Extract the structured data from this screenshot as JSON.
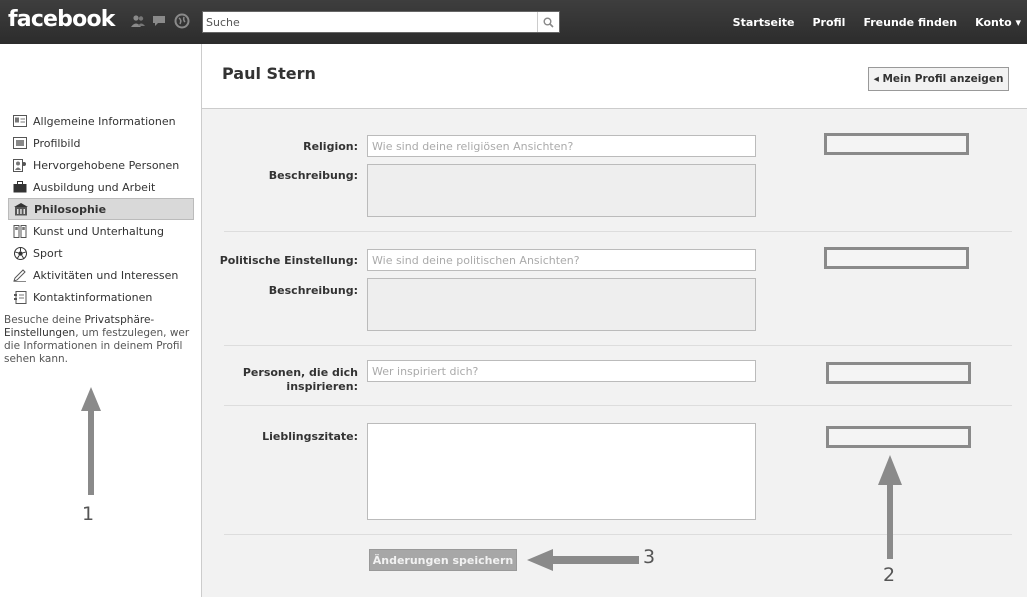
{
  "header": {
    "logo": "facebook",
    "search_placeholder": "Suche",
    "nav": [
      "Startseite",
      "Profil",
      "Freunde finden",
      "Konto ▾"
    ]
  },
  "profile": {
    "name": "Paul Stern",
    "view_button": "◂ Mein Profil anzeigen"
  },
  "sidebar": {
    "items": [
      {
        "label": "Allgemeine Informationen",
        "icon": "info-card-icon"
      },
      {
        "label": "Profilbild",
        "icon": "picture-icon"
      },
      {
        "label": "Hervorgehobene Personen",
        "icon": "people-icon"
      },
      {
        "label": "Ausbildung und Arbeit",
        "icon": "briefcase-icon"
      },
      {
        "label": "Philosophie",
        "icon": "building-icon",
        "active": true
      },
      {
        "label": "Kunst und Unterhaltung",
        "icon": "film-icon"
      },
      {
        "label": "Sport",
        "icon": "soccer-ball-icon"
      },
      {
        "label": "Aktivitäten und Interessen",
        "icon": "pencil-icon"
      },
      {
        "label": "Kontaktinformationen",
        "icon": "contact-book-icon"
      }
    ],
    "note_prefix": "Besuche deine ",
    "note_link": "Privatsphäre-Einstellungen",
    "note_suffix": ", um festzulegen, wer die Informationen in deinem Profil sehen kann."
  },
  "form": {
    "religion_label": "Religion:",
    "religion_placeholder": "Wie sind deine religiösen Ansichten?",
    "religion_desc_label": "Beschreibung:",
    "politics_label": "Politische Einstellung:",
    "politics_placeholder": "Wie sind deine politischen Ansichten?",
    "politics_desc_label": "Beschreibung:",
    "inspire_label_1": "Personen, die dich",
    "inspire_label_2": "inspirieren:",
    "inspire_placeholder": "Wer inspiriert dich?",
    "quotes_label": "Lieblingszitate:",
    "save_button": "Änderungen speichern"
  },
  "annotations": {
    "marker_1": "1",
    "marker_2": "2",
    "marker_3": "3"
  }
}
